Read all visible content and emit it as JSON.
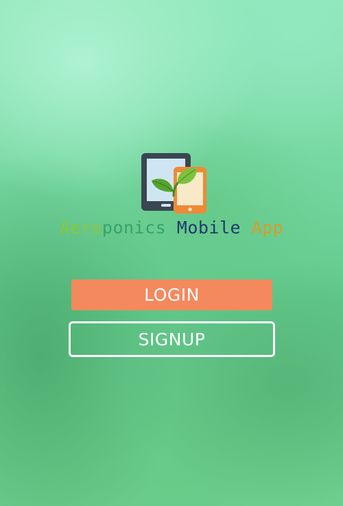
{
  "app": {
    "title_parts": [
      {
        "text": "Aero",
        "color": "#8cc63f"
      },
      {
        "text": "ponics",
        "color": "#35a36a"
      },
      {
        "text": " ",
        "color": "#ffffff"
      },
      {
        "text": "Mobile",
        "color": "#1e3a6b"
      },
      {
        "text": " ",
        "color": "#ffffff"
      },
      {
        "text": "App",
        "color": "#d99a2b"
      }
    ],
    "logo_icon": "tablet-phone-leaf-icon"
  },
  "buttons": {
    "login_label": "LOGIN",
    "signup_label": "SIGNUP"
  },
  "colors": {
    "login_bg": "#f5895e",
    "signup_border": "#ffffff"
  }
}
